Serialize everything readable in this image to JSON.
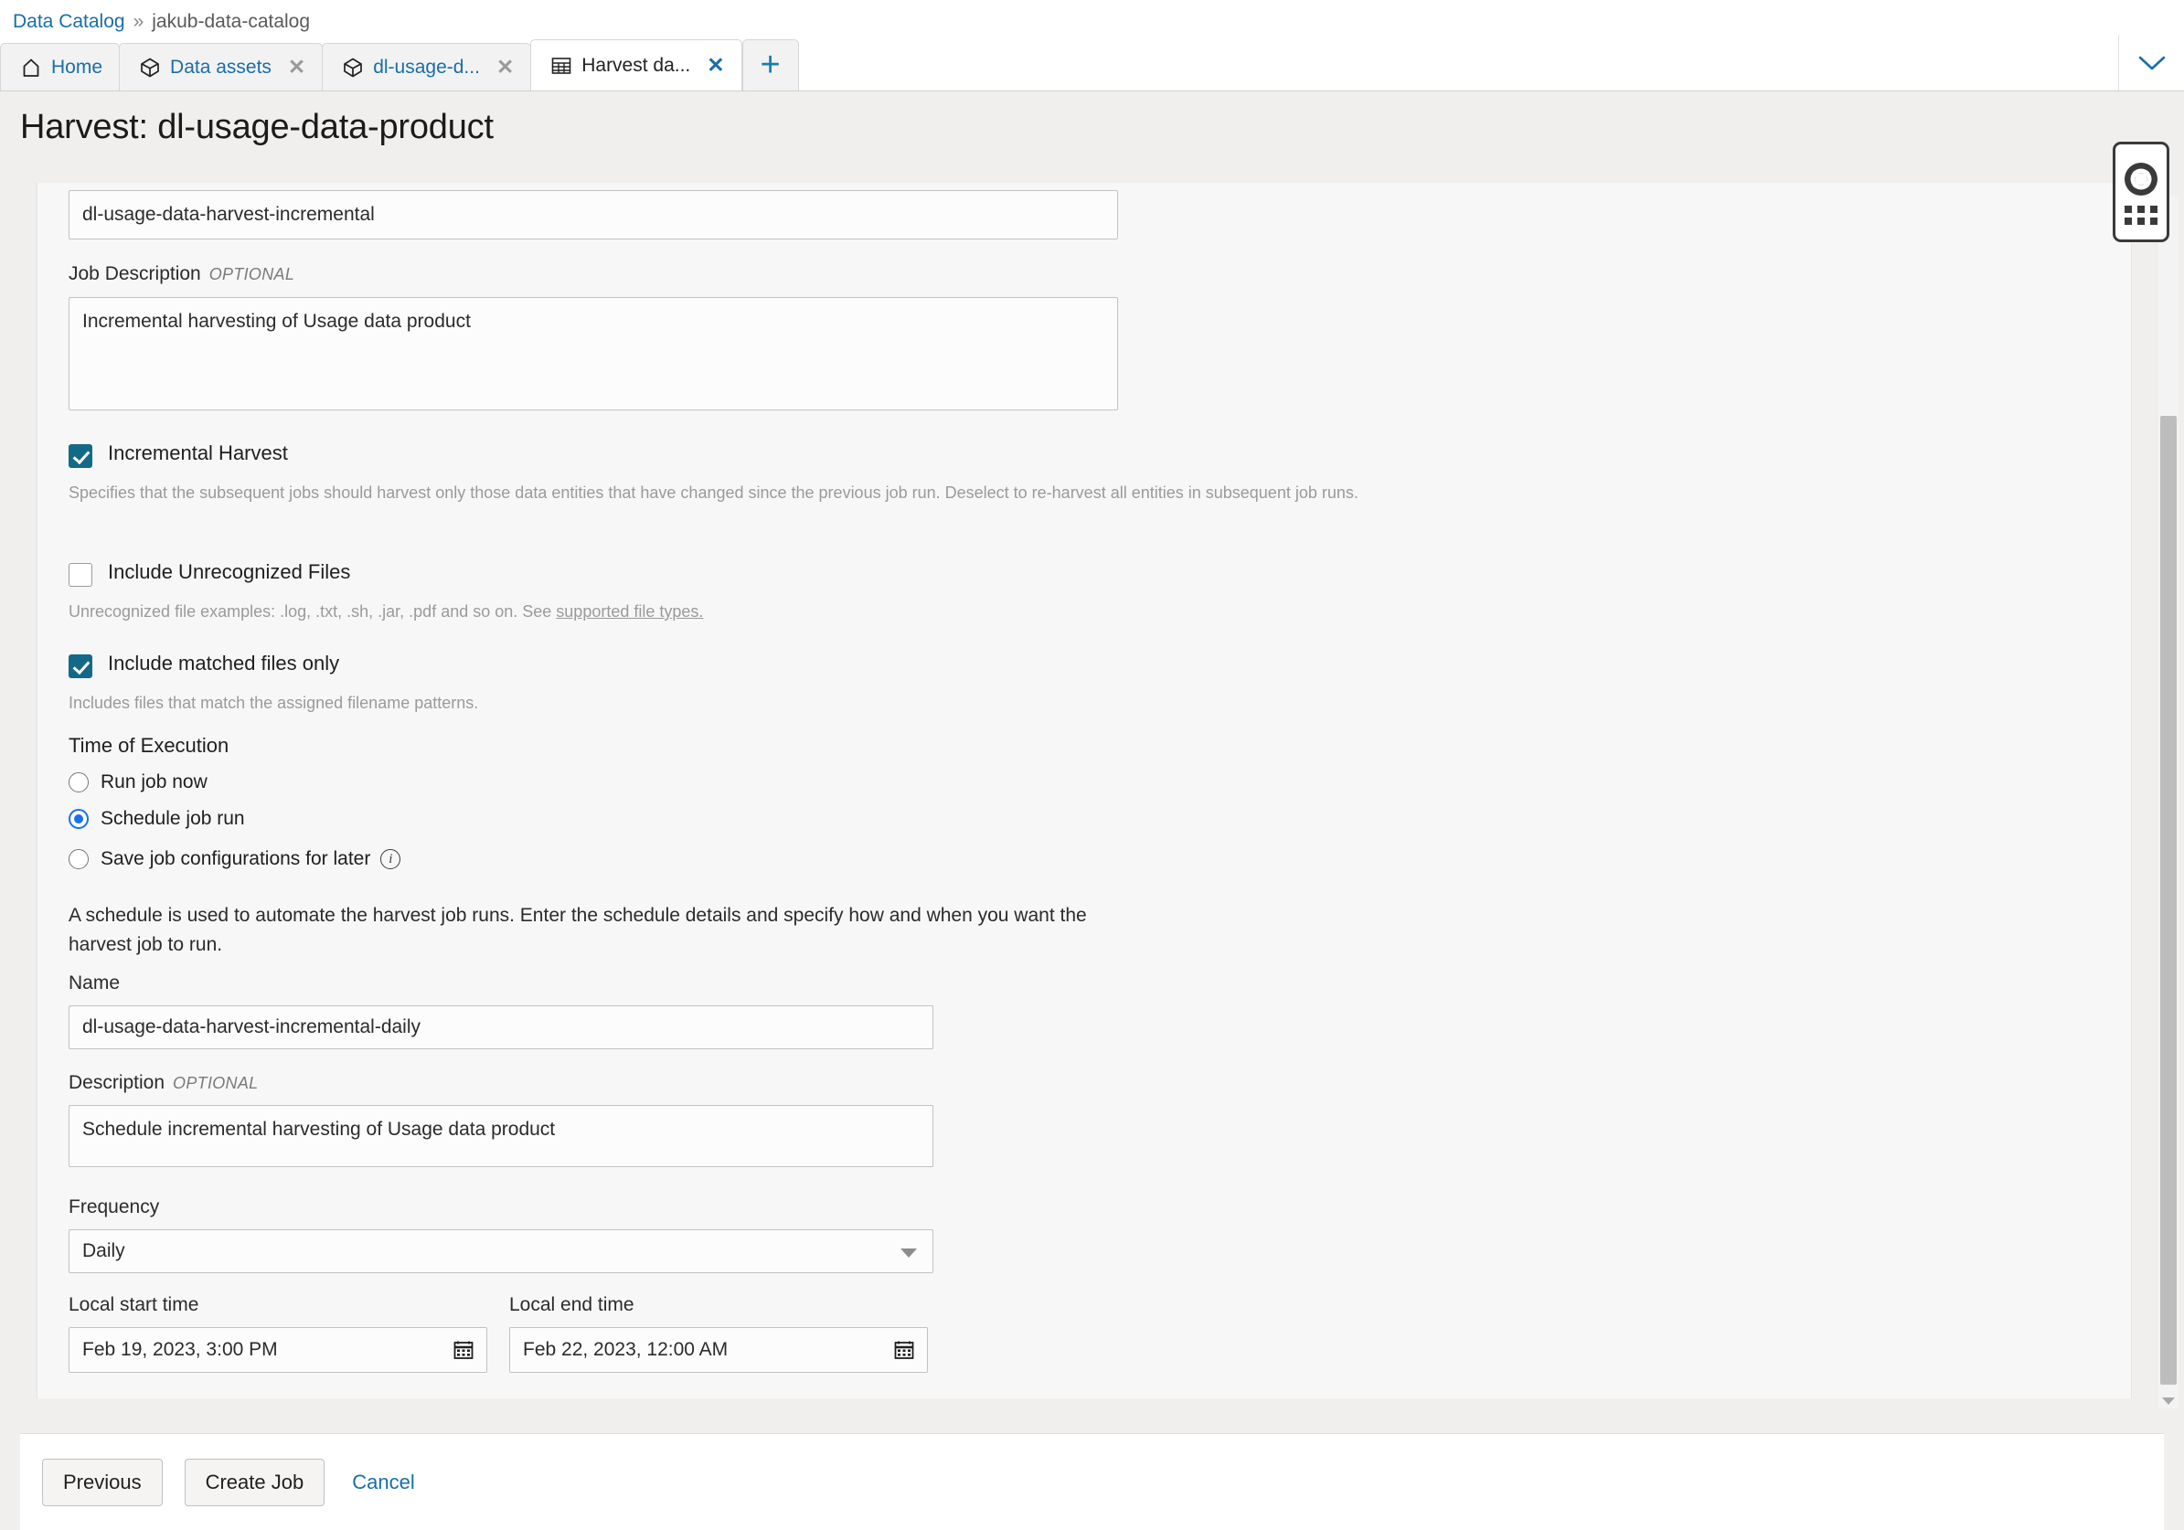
{
  "breadcrumb": {
    "root": "Data Catalog",
    "separator": "»",
    "current": "jakub-data-catalog"
  },
  "tabs": [
    {
      "label": "Home",
      "icon": "home-icon",
      "closable": false,
      "active": false
    },
    {
      "label": "Data assets",
      "icon": "cube-icon",
      "closable": true,
      "active": false
    },
    {
      "label": "dl-usage-d...",
      "icon": "cube-icon",
      "closable": true,
      "active": false
    },
    {
      "label": "Harvest da...",
      "icon": "table-grid-icon",
      "closable": true,
      "active": true
    }
  ],
  "tab_add_label": "+",
  "tabbar_overflow_icon": "chevron-down-icon",
  "page": {
    "title": "Harvest: dl-usage-data-product"
  },
  "form": {
    "job_name_value": "dl-usage-data-harvest-incremental",
    "job_description_label": "Job Description",
    "optional_tag": "OPTIONAL",
    "job_description_value": "Incremental harvesting of Usage data product",
    "incremental_harvest": {
      "label": "Incremental Harvest",
      "checked": true,
      "help": "Specifies that the subsequent jobs should harvest only those data entities that have changed since the previous job run. Deselect to re-harvest all entities in subsequent job runs."
    },
    "include_unrecognized": {
      "label": "Include Unrecognized Files",
      "checked": false,
      "help_prefix": "Unrecognized file examples: .log, .txt, .sh, .jar, .pdf and so on. See ",
      "help_link": "supported file types."
    },
    "include_matched": {
      "label": "Include matched files only",
      "checked": true,
      "help": "Includes files that match the assigned filename patterns."
    },
    "time_of_execution": {
      "heading": "Time of Execution",
      "options": [
        {
          "label": "Run job now",
          "selected": false
        },
        {
          "label": "Schedule job run",
          "selected": true
        },
        {
          "label": "Save job configurations for later",
          "selected": false,
          "info_icon": "info-icon"
        }
      ]
    },
    "schedule_intro": "A schedule is used to automate the harvest job runs. Enter the schedule details and specify how and when you want the harvest job to run.",
    "schedule_name_label": "Name",
    "schedule_name_value": "dl-usage-data-harvest-incremental-daily",
    "schedule_desc_label": "Description",
    "schedule_desc_value": "Schedule incremental harvesting of Usage data product",
    "frequency_label": "Frequency",
    "frequency_value": "Daily",
    "frequency_options": [
      "Daily"
    ],
    "start_time_label": "Local start time",
    "start_time_value": "Feb 19, 2023, 3:00 PM",
    "end_time_label": "Local end time",
    "end_time_value": "Feb 22, 2023, 12:00 AM",
    "calendar_icon": "calendar-icon"
  },
  "footer": {
    "previous": "Previous",
    "create_job": "Create Job",
    "cancel": "Cancel"
  },
  "help_widget": {
    "icon": "lifesaver-icon",
    "handle_icon": "drag-dots-icon"
  },
  "colors": {
    "link": "#1a6ea8",
    "checkbox_checked": "#126a88",
    "radio_selected": "#1871e8",
    "title_band": "#f0efed",
    "panel_bg": "#f7f7f7"
  }
}
